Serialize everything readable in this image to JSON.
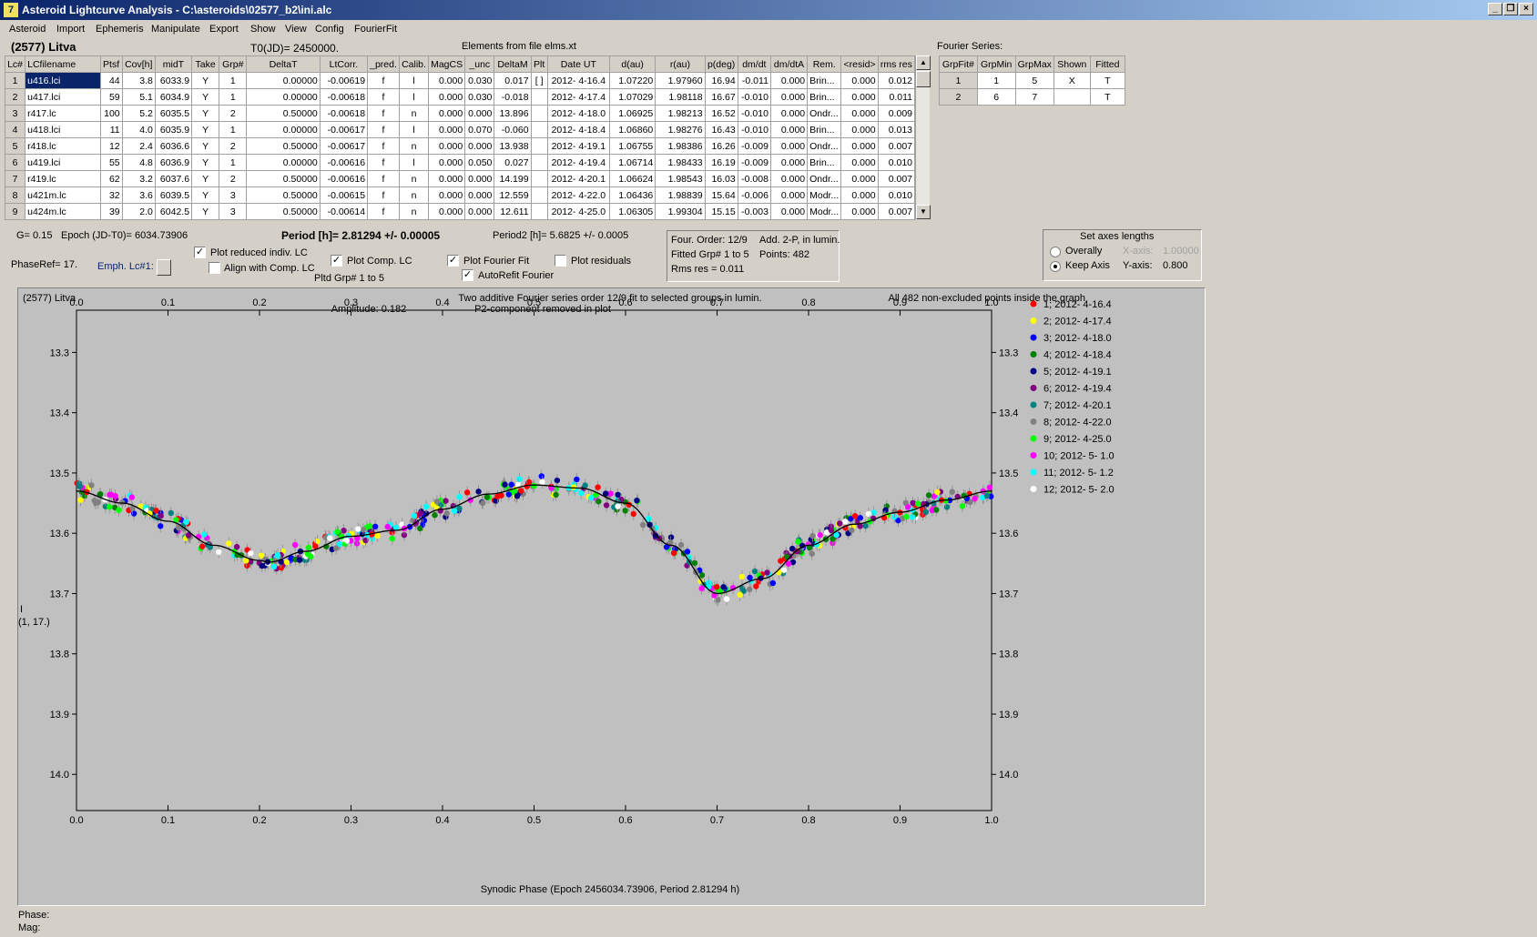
{
  "window": {
    "title": "Asteroid Lightcurve Analysis - C:\\asteroids\\02577_b2\\ini.alc",
    "icon_name": "app-icon"
  },
  "menu": [
    "Asteroid",
    "Import",
    "Ephemeris",
    "Manipulate",
    "Export",
    "Show",
    "View",
    "Config",
    "FourierFit"
  ],
  "header": {
    "asteroid": "(2577) Litva",
    "t0": "T0(JD)= 2450000.",
    "elements": "Elements from file elms.xt"
  },
  "lc_table": {
    "columns": [
      "Lc#",
      "LCfilename",
      "Ptsf",
      "Cov[h]",
      "midT",
      "Take",
      "Grp#",
      "DeltaT",
      "LtCorr.",
      "_pred.",
      "Calib.",
      "MagCS",
      "_unc",
      "DeltaM",
      "Plt",
      "Date UT",
      "d(au)",
      "r(au)",
      "p(deg)",
      "dm/dt",
      "dm/dtA",
      "Rem.",
      "<resid>",
      "rms res"
    ],
    "rows": [
      [
        "1",
        "u416.lci",
        "44",
        "3.8",
        "6033.9",
        "Y",
        "1",
        "0.00000",
        "-0.00619",
        "f",
        "l",
        "0.000",
        "0.030",
        "0.017",
        "[ ]",
        "2012- 4-16.4",
        "1.07220",
        "1.97960",
        "16.94",
        "-0.011",
        "0.000",
        "Brin...",
        "0.000",
        "0.012"
      ],
      [
        "2",
        "u417.lci",
        "59",
        "5.1",
        "6034.9",
        "Y",
        "1",
        "0.00000",
        "-0.00618",
        "f",
        "l",
        "0.000",
        "0.030",
        "-0.018",
        "",
        "2012- 4-17.4",
        "1.07029",
        "1.98118",
        "16.67",
        "-0.010",
        "0.000",
        "Brin...",
        "0.000",
        "0.011"
      ],
      [
        "3",
        "r417.lc",
        "100",
        "5.2",
        "6035.5",
        "Y",
        "2",
        "0.50000",
        "-0.00618",
        "f",
        "n",
        "0.000",
        "0.000",
        "13.896",
        "",
        "2012- 4-18.0",
        "1.06925",
        "1.98213",
        "16.52",
        "-0.010",
        "0.000",
        "Ondr...",
        "0.000",
        "0.009"
      ],
      [
        "4",
        "u418.lci",
        "11",
        "4.0",
        "6035.9",
        "Y",
        "1",
        "0.00000",
        "-0.00617",
        "f",
        "l",
        "0.000",
        "0.070",
        "-0.060",
        "",
        "2012- 4-18.4",
        "1.06860",
        "1.98276",
        "16.43",
        "-0.010",
        "0.000",
        "Brin...",
        "0.000",
        "0.013"
      ],
      [
        "5",
        "r418.lc",
        "12",
        "2.4",
        "6036.6",
        "Y",
        "2",
        "0.50000",
        "-0.00617",
        "f",
        "n",
        "0.000",
        "0.000",
        "13.938",
        "",
        "2012- 4-19.1",
        "1.06755",
        "1.98386",
        "16.26",
        "-0.009",
        "0.000",
        "Ondr...",
        "0.000",
        "0.007"
      ],
      [
        "6",
        "u419.lci",
        "55",
        "4.8",
        "6036.9",
        "Y",
        "1",
        "0.00000",
        "-0.00616",
        "f",
        "l",
        "0.000",
        "0.050",
        "0.027",
        "",
        "2012- 4-19.4",
        "1.06714",
        "1.98433",
        "16.19",
        "-0.009",
        "0.000",
        "Brin...",
        "0.000",
        "0.010"
      ],
      [
        "7",
        "r419.lc",
        "62",
        "3.2",
        "6037.6",
        "Y",
        "2",
        "0.50000",
        "-0.00616",
        "f",
        "n",
        "0.000",
        "0.000",
        "14.199",
        "",
        "2012- 4-20.1",
        "1.06624",
        "1.98543",
        "16.03",
        "-0.008",
        "0.000",
        "Ondr...",
        "0.000",
        "0.007"
      ],
      [
        "8",
        "u421m.lc",
        "32",
        "3.6",
        "6039.5",
        "Y",
        "3",
        "0.50000",
        "-0.00615",
        "f",
        "n",
        "0.000",
        "0.000",
        "12.559",
        "",
        "2012- 4-22.0",
        "1.06436",
        "1.98839",
        "15.64",
        "-0.006",
        "0.000",
        "Modr...",
        "0.000",
        "0.010"
      ],
      [
        "9",
        "u424m.lc",
        "39",
        "2.0",
        "6042.5",
        "Y",
        "3",
        "0.50000",
        "-0.00614",
        "f",
        "n",
        "0.000",
        "0.000",
        "12.611",
        "",
        "2012- 4-25.0",
        "1.06305",
        "1.99304",
        "15.15",
        "-0.003",
        "0.000",
        "Modr...",
        "0.000",
        "0.007"
      ]
    ],
    "scroll_up": "▲",
    "scroll_down": "▼"
  },
  "fourier_series": {
    "title": "Fourier Series:",
    "columns": [
      "GrpFit#",
      "GrpMin",
      "GrpMax",
      "Shown",
      "Fitted"
    ],
    "rows": [
      [
        "1",
        "1",
        "5",
        "X",
        "T"
      ],
      [
        "2",
        "6",
        "7",
        "",
        "T"
      ]
    ]
  },
  "params": {
    "g": "G= 0.15",
    "epoch": "Epoch (JD-T0)= 6034.73906",
    "period": "Period [h]= 2.81294 +/- 0.00005",
    "period2": "Period2 [h]= 5.6825 +/- 0.0005",
    "phase_ref": "PhaseRef= 17.",
    "emph_lc": "Emph. Lc#1:",
    "pltd_grp": "Pltd Grp#  1   to   5"
  },
  "options": {
    "plot_reduced": {
      "label": "Plot reduced indiv. LC",
      "checked": true
    },
    "align_comp": {
      "label": "Align with Comp. LC",
      "checked": false
    },
    "plot_comp": {
      "label": "Plot Comp. LC",
      "checked": true
    },
    "plot_fourier": {
      "label": "Plot Fourier Fit",
      "checked": true
    },
    "autorefit": {
      "label": "AutoRefit Fourier",
      "checked": true
    },
    "plot_residuals": {
      "label": "Plot residuals",
      "checked": false
    }
  },
  "fourier_info": {
    "order": "Four. Order: 12/9",
    "add": "Add. 2-P,  in lumin.",
    "fitted": "Fitted Grp# 1 to 5",
    "points": "Points: 482",
    "rms": "Rms res     = 0.011"
  },
  "axes_box": {
    "title": "Set axes lengths",
    "overally": "Overally",
    "keep_axis": "Keep Axis",
    "x_axis_label": "X-axis:",
    "x_axis_value": "1.00000",
    "y_axis_label": "Y-axis:",
    "y_axis_value": "0.800",
    "selected": "keep_axis"
  },
  "plot": {
    "name": "(2577) Litva",
    "title1": "Two additive Fourier series order 12/9 fit to selected groups in lumin.",
    "amplitude": "Amplitude: 0.182",
    "p2_note": "P2-component removed in plot",
    "points_note": "All 482 non-excluded points inside the graph",
    "y_label_1": "I",
    "y_label_2": "(1, 17.)",
    "x_label": "Synodic Phase (Epoch 2456034.73906, Period 2.81294 h)",
    "phase_label": "Phase:",
    "mag_label": "Mag:"
  },
  "chart_data": {
    "type": "scatter",
    "title": "Two additive Fourier series order 12/9 fit to selected groups in lumin.",
    "xlabel": "Synodic Phase (Epoch 2456034.73906, Period 2.81294 h)",
    "ylabel": "I (1, 17.)",
    "xlim": [
      0.0,
      1.0
    ],
    "ylim": [
      14.06,
      13.23
    ],
    "y_inverted": true,
    "x_ticks": [
      "0.0",
      "0.1",
      "0.2",
      "0.3",
      "0.4",
      "0.5",
      "0.6",
      "0.7",
      "0.8",
      "0.9",
      "1.0"
    ],
    "y_ticks": [
      "13.3",
      "13.4",
      "13.5",
      "13.6",
      "13.7",
      "13.8",
      "13.9",
      "14.0"
    ],
    "legend_position": "right",
    "fourier_fit": {
      "x": [
        0.0,
        0.05,
        0.1,
        0.15,
        0.2,
        0.21,
        0.25,
        0.3,
        0.35,
        0.4,
        0.45,
        0.5,
        0.55,
        0.6,
        0.65,
        0.7,
        0.75,
        0.8,
        0.85,
        0.9,
        0.95,
        1.0
      ],
      "y": [
        13.53,
        13.55,
        13.58,
        13.62,
        13.645,
        13.648,
        13.63,
        13.605,
        13.595,
        13.56,
        13.535,
        13.52,
        13.525,
        13.55,
        13.62,
        13.7,
        13.675,
        13.62,
        13.585,
        13.565,
        13.545,
        13.53
      ]
    },
    "series": [
      {
        "name": "1; 2012- 4-16.4",
        "color": "#ff0000"
      },
      {
        "name": "2; 2012- 4-17.4",
        "color": "#ffff00"
      },
      {
        "name": "3; 2012- 4-18.0",
        "color": "#0000ff"
      },
      {
        "name": "4; 2012- 4-18.4",
        "color": "#008000"
      },
      {
        "name": "5; 2012- 4-19.1",
        "color": "#000080"
      },
      {
        "name": "6; 2012- 4-19.4",
        "color": "#800080"
      },
      {
        "name": "7; 2012- 4-20.1",
        "color": "#008080"
      },
      {
        "name": "8; 2012- 4-22.0",
        "color": "#808080"
      },
      {
        "name": "9; 2012- 4-25.0",
        "color": "#00ff00"
      },
      {
        "name": "10; 2012- 5- 1.0",
        "color": "#ff00ff"
      },
      {
        "name": "11; 2012- 5- 1.2",
        "color": "#00ffff"
      },
      {
        "name": "12; 2012- 5- 2.0",
        "color": "#ffffff"
      }
    ],
    "n_points": 482
  }
}
